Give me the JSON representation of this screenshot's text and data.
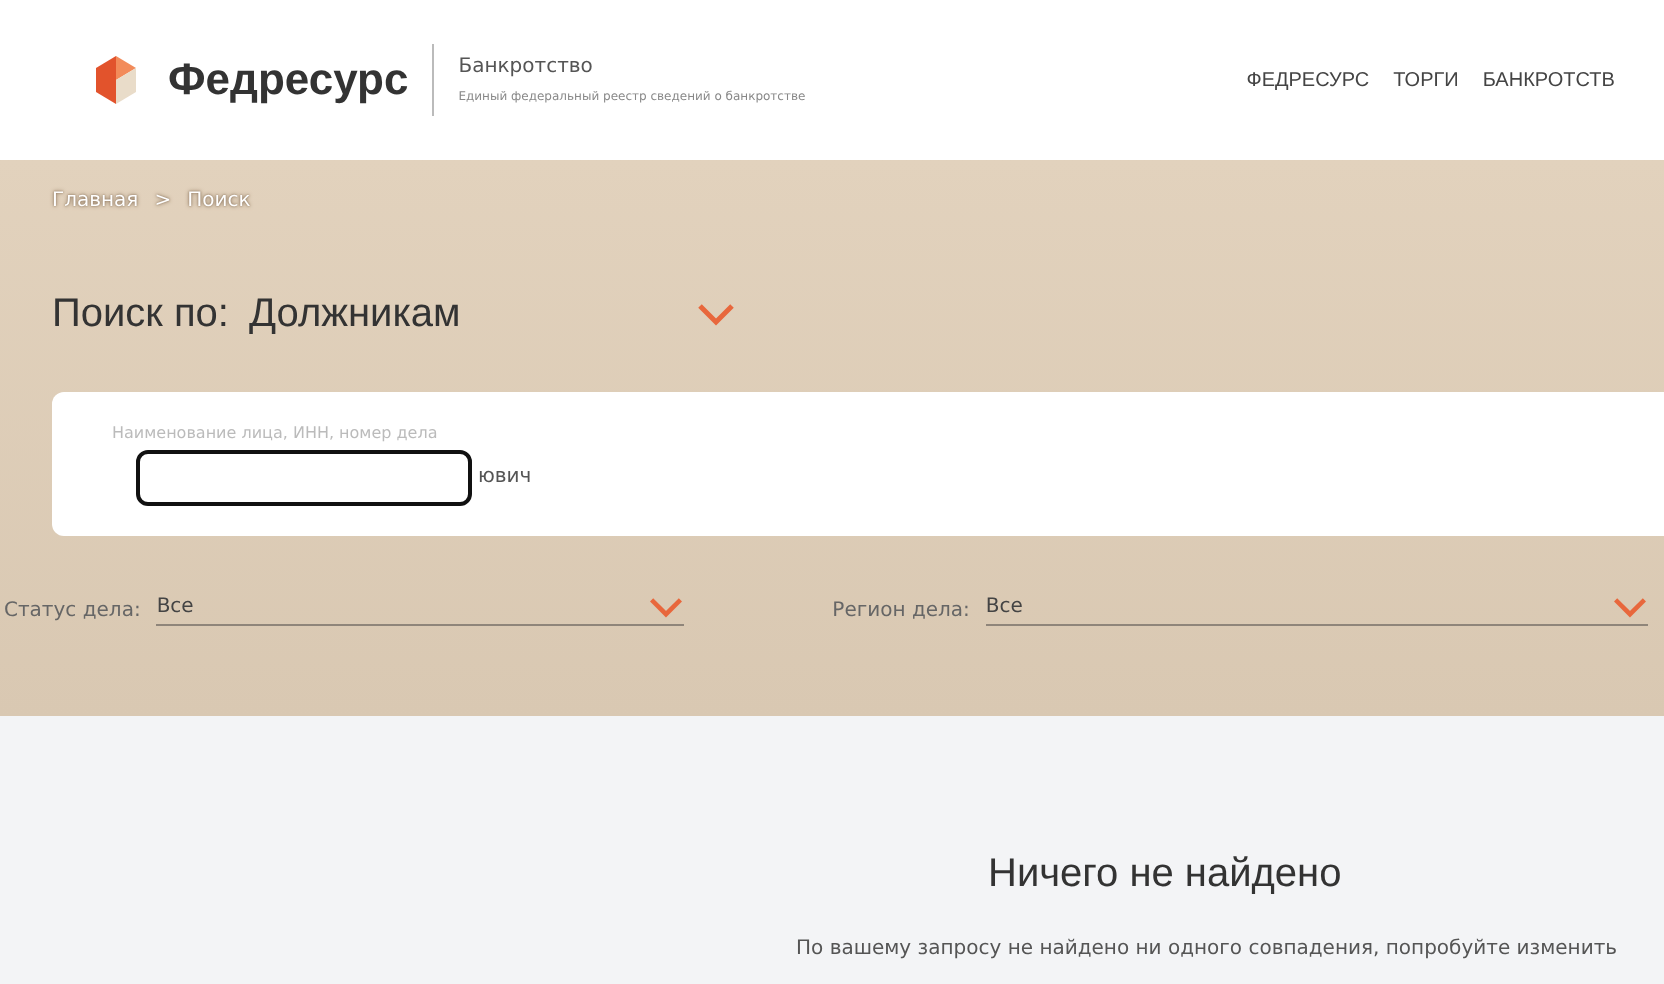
{
  "header": {
    "logo_text": "Федресурс",
    "section_title": "Банкротство",
    "section_subtitle": "Единый федеральный реестр сведений о банкротстве",
    "nav": [
      {
        "label": "ФЕДРЕСУРС"
      },
      {
        "label": "ТОРГИ"
      },
      {
        "label": "БАНКРОТСТВ"
      }
    ]
  },
  "breadcrumbs": [
    {
      "label": "Главная"
    },
    {
      "label": "Поиск"
    }
  ],
  "breadcrumb_separator": ">",
  "search_by": {
    "label": "Поиск по:",
    "value": "Должникам"
  },
  "search_field": {
    "placeholder": "Наименование лица, ИНН, номер дела",
    "value": "ювич",
    "redacted": true
  },
  "filters": [
    {
      "label": "Статус дела:",
      "value": "Все"
    },
    {
      "label": "Регион дела:",
      "value": "Все"
    }
  ],
  "result": {
    "title": "Ничего не найдено",
    "message": "По вашему запросу не найдено ни одного совпадения, попробуйте изменить"
  }
}
